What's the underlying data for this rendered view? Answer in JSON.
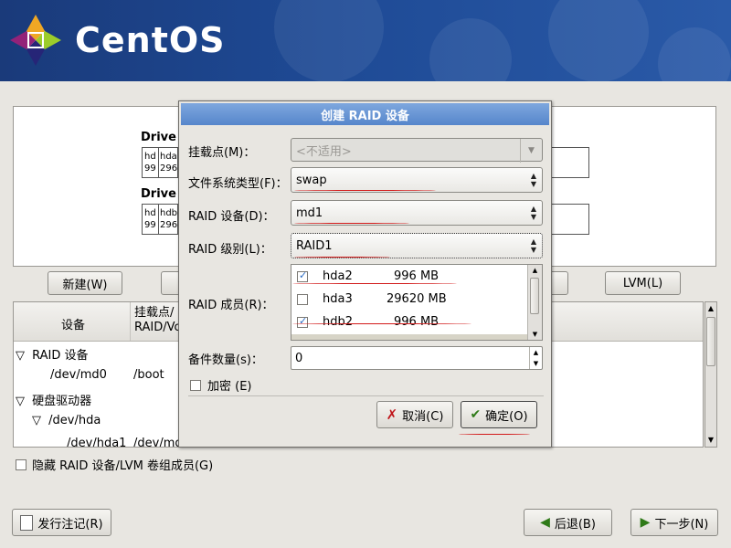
{
  "banner": {
    "brand": "CentOS"
  },
  "partition_buttons": {
    "new": "新建(W)",
    "lvm": "LVM(L)"
  },
  "drives": [
    {
      "label": "Drive",
      "cells": [
        "hd 99",
        "hda 296"
      ]
    },
    {
      "label": "Drive",
      "cells": [
        "hd 99",
        "hdb 296"
      ]
    }
  ],
  "tree": {
    "col_device": "设备",
    "col_mount": "挂载点/\nRAID/Vo",
    "rows": [
      {
        "text": "RAID 设备",
        "expanded": true,
        "indent": 0
      },
      {
        "text": "/dev/md0",
        "mount": "/boot",
        "indent": 2
      },
      {
        "text": "硬盘驱动器",
        "expanded": true,
        "indent": 0
      },
      {
        "text": "/dev/hda",
        "expanded": true,
        "indent": 1
      },
      {
        "text": "/dev/hda1",
        "mount": "/dev/md0",
        "indent": 2
      }
    ]
  },
  "hide_raid": {
    "label": "隐藏 RAID 设备/LVM 卷组成员(G)",
    "checked": false
  },
  "bottom": {
    "release_notes": "发行注记(R)",
    "back": "后退(B)",
    "next": "下一步(N)"
  },
  "dialog": {
    "title": "创建 RAID 设备",
    "mount_label": "挂载点(M)：",
    "mount_value": "<不适用>",
    "fs_label": "文件系统类型(F)：",
    "fs_value": "swap",
    "raid_device_label": "RAID 设备(D)：",
    "raid_device_value": "md1",
    "raid_level_label": "RAID 级别(L)：",
    "raid_level_value": "RAID1",
    "members_label": "RAID 成员(R)：",
    "members": [
      {
        "name": "hda2",
        "size": "996 MB",
        "checked": true
      },
      {
        "name": "hda3",
        "size": "29620 MB",
        "checked": false
      },
      {
        "name": "hdb2",
        "size": "996 MB",
        "checked": true
      }
    ],
    "spares_label": "备件数量(s)：",
    "spares_value": "0",
    "encrypt_label": "加密 (E)",
    "encrypt_checked": false,
    "cancel": "取消(C)",
    "ok": "确定(O)"
  }
}
